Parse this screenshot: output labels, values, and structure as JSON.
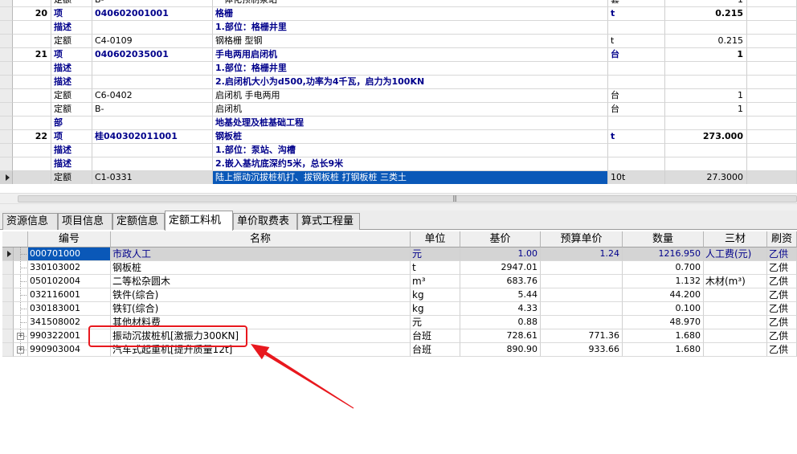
{
  "upper_rows": [
    {
      "num": "",
      "type": "定额",
      "code": "B-",
      "name": "一体化预制泵站",
      "unit": "套",
      "qty": "1",
      "bold": false,
      "current": false
    },
    {
      "num": "20",
      "type": "项",
      "code": "040602001001",
      "name": "格栅",
      "unit": "t",
      "qty": "0.215",
      "bold": true,
      "current": false
    },
    {
      "num": "",
      "type": "描述",
      "code": "",
      "name": "1.部位：格栅井里",
      "unit": "",
      "qty": "",
      "bold": true,
      "current": false
    },
    {
      "num": "",
      "type": "定额",
      "code": "C4-0109",
      "name": "钢格栅 型钢",
      "unit": "t",
      "qty": "0.215",
      "bold": false,
      "current": false
    },
    {
      "num": "21",
      "type": "项",
      "code": "040602035001",
      "name": "手电两用启闭机",
      "unit": "台",
      "qty": "1",
      "bold": true,
      "current": false
    },
    {
      "num": "",
      "type": "描述",
      "code": "",
      "name": "1.部位：格栅井里",
      "unit": "",
      "qty": "",
      "bold": true,
      "current": false
    },
    {
      "num": "",
      "type": "描述",
      "code": "",
      "name": "2.启闭机大小为d500,功率为4千瓦，启力为100KN",
      "unit": "",
      "qty": "",
      "bold": true,
      "current": false
    },
    {
      "num": "",
      "type": "定额",
      "code": "C6-0402",
      "name": "启闭机 手电两用",
      "unit": "台",
      "qty": "1",
      "bold": false,
      "current": false
    },
    {
      "num": "",
      "type": "定额",
      "code": "B-",
      "name": "启闭机",
      "unit": "台",
      "qty": "1",
      "bold": false,
      "current": false
    },
    {
      "num": "",
      "type": "部",
      "code": "",
      "name": "地基处理及桩基础工程",
      "unit": "",
      "qty": "",
      "bold": true,
      "current": false
    },
    {
      "num": "22",
      "type": "项",
      "code": "桂040302011001",
      "name": "钢板桩",
      "unit": "t",
      "qty": "273.000",
      "bold": true,
      "current": false
    },
    {
      "num": "",
      "type": "描述",
      "code": "",
      "name": "1.部位：泵站、沟槽",
      "unit": "",
      "qty": "",
      "bold": true,
      "current": false
    },
    {
      "num": "",
      "type": "描述",
      "code": "",
      "name": "2.嵌入基坑底深约5米，总长9米",
      "unit": "",
      "qty": "",
      "bold": true,
      "current": false
    },
    {
      "num": "",
      "type": "定额",
      "code": "C1-0331",
      "name": "陆上振动沉拔桩机打、拔钢板桩 打钢板桩 三类土",
      "unit": "10t",
      "qty": "27.3000",
      "bold": false,
      "current": true
    }
  ],
  "tabs": [
    "资源信息",
    "项目信息",
    "定额信息",
    "定额工料机",
    "单价取费表",
    "算式工程量"
  ],
  "active_tab": 3,
  "lower_headers": {
    "code": "编号",
    "name": "名称",
    "unit": "单位",
    "base": "基价",
    "budget": "预算单价",
    "qty": "数量",
    "material": "三材",
    "supply": "刷资"
  },
  "lower_rows": [
    {
      "code": "000701000",
      "name": "市政人工",
      "unit": "元",
      "base": "1.00",
      "budget": "1.24",
      "qty": "1216.950",
      "material": "人工费(元)",
      "supply": "乙供",
      "selected": true,
      "expand": false
    },
    {
      "code": "330103002",
      "name": "钢板桩",
      "unit": "t",
      "base": "2947.01",
      "budget": "",
      "qty": "0.700",
      "material": "",
      "supply": "乙供",
      "selected": false,
      "expand": false
    },
    {
      "code": "050102004",
      "name": "二等松杂圆木",
      "unit": "m³",
      "base": "683.76",
      "budget": "",
      "qty": "1.132",
      "material": "木材(m³)",
      "supply": "乙供",
      "selected": false,
      "expand": false
    },
    {
      "code": "032116001",
      "name": "铁件(综合)",
      "unit": "kg",
      "base": "5.44",
      "budget": "",
      "qty": "44.200",
      "material": "",
      "supply": "乙供",
      "selected": false,
      "expand": false
    },
    {
      "code": "030183001",
      "name": "铁钉(综合)",
      "unit": "kg",
      "base": "4.33",
      "budget": "",
      "qty": "0.100",
      "material": "",
      "supply": "乙供",
      "selected": false,
      "expand": false
    },
    {
      "code": "341508002",
      "name": "其他材料费",
      "unit": "元",
      "base": "0.88",
      "budget": "",
      "qty": "48.970",
      "material": "",
      "supply": "乙供",
      "selected": false,
      "expand": false
    },
    {
      "code": "990322001",
      "name": "振动沉拔桩机[激振力300KN]",
      "unit": "台班",
      "base": "728.61",
      "budget": "771.36",
      "qty": "1.680",
      "material": "",
      "supply": "乙供",
      "selected": false,
      "expand": true
    },
    {
      "code": "990903004",
      "name": "汽车式起重机[提升质量12t]",
      "unit": "台班",
      "base": "890.90",
      "budget": "933.66",
      "qty": "1.680",
      "material": "",
      "supply": "乙供",
      "selected": false,
      "expand": true
    }
  ],
  "annotation_color": "#e8181e"
}
